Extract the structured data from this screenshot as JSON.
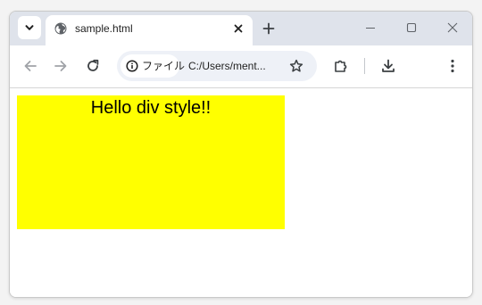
{
  "browser": {
    "tab": {
      "title": "sample.html",
      "favicon": "globe-icon"
    },
    "tab_search_icon": "chevron-down-icon",
    "new_tab_icon": "plus-icon",
    "window_controls": [
      "minimize-icon",
      "maximize-icon",
      "close-icon"
    ],
    "toolbar": {
      "back_icon": "arrow-left-icon",
      "forward_icon": "arrow-right-icon",
      "reload_icon": "reload-icon",
      "site_chip_label": "ファイル",
      "site_chip_icon": "info-icon",
      "url": "C:/Users/ment...",
      "bookmark_icon": "star-icon",
      "extensions_icon": "puzzle-icon",
      "downloads_icon": "download-icon",
      "menu_icon": "kebab-menu-icon"
    },
    "colors": {
      "tabstrip": "#dfe3eb",
      "omnibox": "#eef1f7"
    }
  },
  "page": {
    "div_text": "Hello div style!!",
    "div_background": "#ffff00"
  }
}
